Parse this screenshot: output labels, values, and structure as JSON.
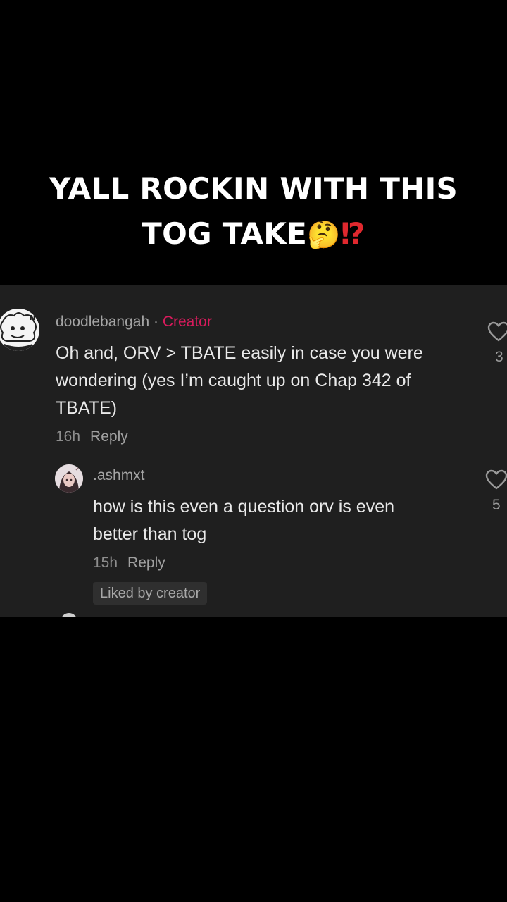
{
  "video": {
    "caption_line1": "YALL ROCKIN WITH THIS",
    "caption_line2": "TOG TAKE",
    "caption_emoji": "🤔",
    "caption_punct": "⁉"
  },
  "comments": [
    {
      "username": "doodlebangah",
      "separator": "·",
      "badge": "Creator",
      "text_lines": [
        "Oh and, ORV > TBATE easily in case you were",
        "wondering (yes I’m caught up on Chap 342 of",
        "TBATE)"
      ],
      "time": "16h",
      "reply_label": "Reply",
      "like_count": "3",
      "icons": {
        "avatar": "avatar-illustration",
        "like": "heart-icon"
      },
      "replies": [
        {
          "username": ".ashmxt",
          "text_lines": [
            "how is this even a question orv is even",
            "better than tog"
          ],
          "time": "15h",
          "reply_label": "Reply",
          "liked_by_creator": "Liked by creator",
          "like_count": "5",
          "icons": {
            "avatar": "avatar-photo",
            "like": "heart-icon"
          }
        }
      ]
    }
  ],
  "colors": {
    "background": "#000000",
    "panel": "#1f1f1f",
    "creator_badge": "#d81b5c",
    "caption_text": "#ffffff",
    "caption_punct": "#e0282e"
  }
}
